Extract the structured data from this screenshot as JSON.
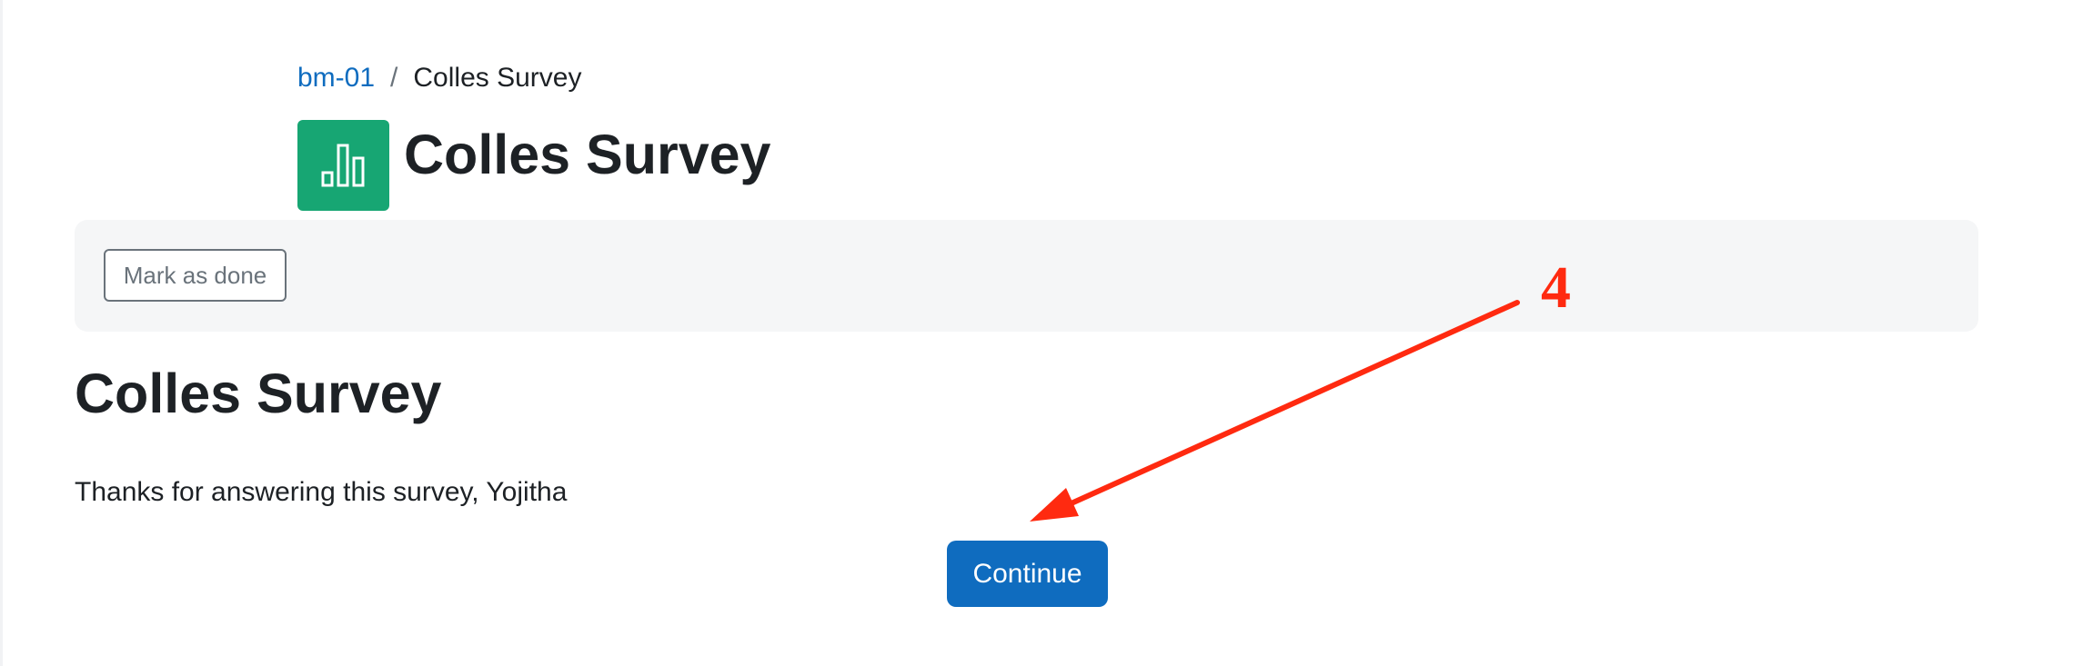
{
  "breadcrumb": {
    "course_link": "bm-01",
    "separator": "/",
    "current": "Colles Survey"
  },
  "header": {
    "icon": "bar-chart-icon",
    "icon_color": "#17a673",
    "title": "Colles Survey"
  },
  "activity_header": {
    "mark_as_done_label": "Mark as done"
  },
  "main": {
    "heading": "Colles Survey",
    "message": "Thanks for answering this survey, Yojitha",
    "continue_label": "Continue"
  },
  "annotation": {
    "number": "4",
    "color": "#ff2a10"
  },
  "colors": {
    "primary": "#0f6cbf",
    "text": "#1d2125",
    "muted": "#6a737b",
    "panel_bg": "#f5f6f7"
  }
}
